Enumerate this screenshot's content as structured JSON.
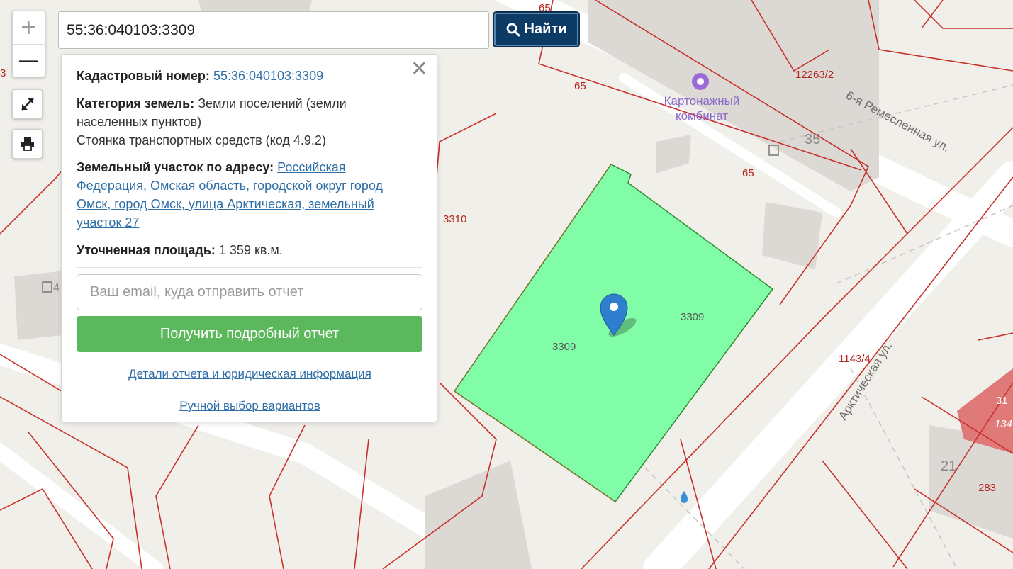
{
  "search": {
    "value": "55:36:040103:3309",
    "button_label": "Найти"
  },
  "controls": {
    "zoom_in": "+",
    "zoom_out": "—",
    "fullscreen_icon": "expand-icon",
    "print_icon": "print-icon"
  },
  "popup": {
    "cadastral_label": "Кадастровый номер:",
    "cadastral_value": "55:36:040103:3309",
    "category_label": "Категория земель:",
    "category_value_line1": "Земли поселений (земли",
    "category_value_line2": "населенных пунктов)",
    "usage_value": "Стоянка транспортных средств (код 4.9.2)",
    "address_label": "Земельный участок по адресу:",
    "address_line1": "Российская",
    "address_line2": "Федерация, Омская область, городской округ город",
    "address_line3": "Омск, город Омск, улица Арктическая, земельный",
    "address_line4": "участок 27",
    "area_label": "Уточненная площадь:",
    "area_value": "1 359 кв.м.",
    "email_placeholder": "Ваш email, куда отправить отчет",
    "report_button": "Получить подробный отчет",
    "details_link": "Детали отчета и юридическая информация",
    "manual_link": "Ручной выбор вариантов"
  },
  "map": {
    "poi_name_line1": "Картонажный",
    "poi_name_line2": "комбинат",
    "street_remeslennaya": "6-я Ремесленная ул.",
    "street_arkticheskaya": "Арктическая ул.",
    "parcel_labels": [
      "65",
      "65",
      "65",
      "12263/2",
      "35",
      "3310",
      "3309",
      "3309",
      "1143/4",
      "21",
      "283",
      "4",
      "3",
      "31",
      "134"
    ],
    "highlight_color": "#80fda6",
    "boundary_color": "#c8312b"
  }
}
